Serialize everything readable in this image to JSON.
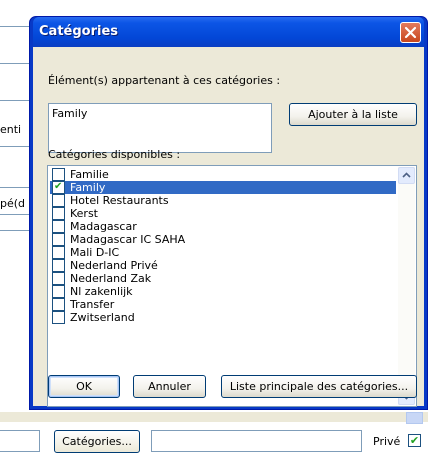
{
  "background": {
    "fragments": [
      "enti",
      "pé(d"
    ],
    "categories_button": "Catégories...",
    "prive_label": "Privé",
    "prive_checked": true
  },
  "dialog": {
    "title": "Catégories",
    "assigned_label": "Élément(s) appartenant à ces catégories :",
    "assigned_value": "Family",
    "add_button": "Ajouter à la liste",
    "available_label": "Catégories disponibles :",
    "categories": [
      {
        "name": "Familie",
        "checked": false,
        "selected": false
      },
      {
        "name": "Family",
        "checked": true,
        "selected": true
      },
      {
        "name": "Hotel Restaurants",
        "checked": false,
        "selected": false
      },
      {
        "name": "Kerst",
        "checked": false,
        "selected": false
      },
      {
        "name": "Madagascar",
        "checked": false,
        "selected": false
      },
      {
        "name": "Madagascar IC SAHA",
        "checked": false,
        "selected": false
      },
      {
        "name": "Mali D-IC",
        "checked": false,
        "selected": false
      },
      {
        "name": "Nederland Privé",
        "checked": false,
        "selected": false
      },
      {
        "name": "Nederland Zak",
        "checked": false,
        "selected": false
      },
      {
        "name": "Nl zakenlijk",
        "checked": false,
        "selected": false
      },
      {
        "name": "Transfer",
        "checked": false,
        "selected": false
      },
      {
        "name": "Zwitserland",
        "checked": false,
        "selected": false
      }
    ],
    "ok_button": "OK",
    "cancel_button": "Annuler",
    "master_list_button": "Liste principale des catégories...",
    "icons": {
      "close": "close-icon",
      "scroll_up": "chevron-up-icon",
      "scroll_down": "chevron-down-icon",
      "check": "checkmark-icon"
    },
    "colors": {
      "titlebar": "#0347d7",
      "selection": "#316ac5",
      "close": "#c8471e",
      "check": "#21a121"
    }
  }
}
